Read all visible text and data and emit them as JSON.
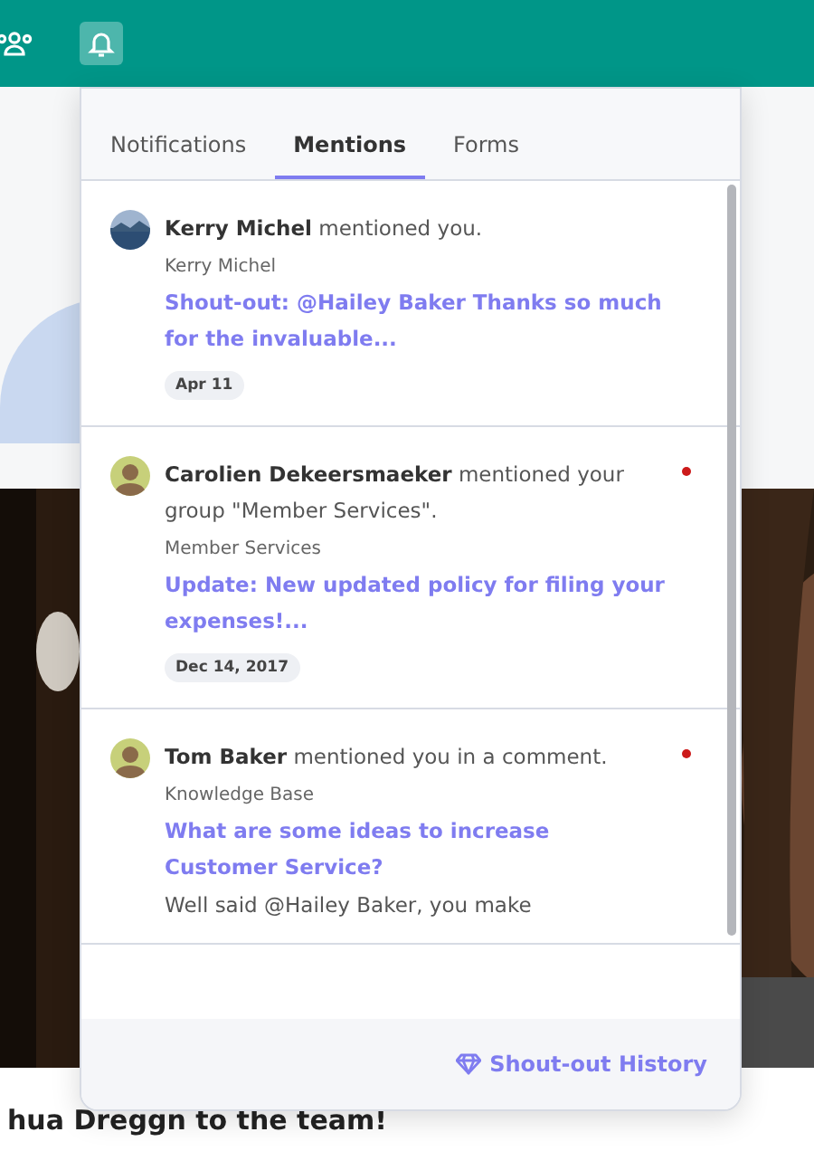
{
  "header": {
    "notifications_active": true
  },
  "tabs": [
    {
      "label": "Notifications",
      "selected": false
    },
    {
      "label": "Mentions",
      "selected": true
    },
    {
      "label": "Forms",
      "selected": false
    }
  ],
  "mentions": [
    {
      "avatar": {
        "kind": "landscape"
      },
      "name": "Kerry Michel",
      "action": "mentioned you.",
      "unread": false,
      "source": "Kerry Michel",
      "title": "Shout-out: @Hailey Baker Thanks so much for the invaluable...",
      "date": "Apr 11"
    },
    {
      "avatar": {
        "kind": "person"
      },
      "name": "Carolien Dekeersmaeker",
      "action": "mentioned your group \"Member Services\".",
      "unread": true,
      "source": "Member Services",
      "title": "Update: New updated policy for filing your expenses!...",
      "date": "Dec 14, 2017"
    },
    {
      "avatar": {
        "kind": "person"
      },
      "name": "Tom Baker",
      "action": "mentioned you in a comment.",
      "unread": true,
      "source": "Knowledge Base",
      "title": "What are some ideas to increase Customer Service?",
      "excerpt": "Well said @Hailey Baker, you make"
    }
  ],
  "footer_link": "Shout-out History",
  "page_heading": "hua Dreggn to the team!"
}
